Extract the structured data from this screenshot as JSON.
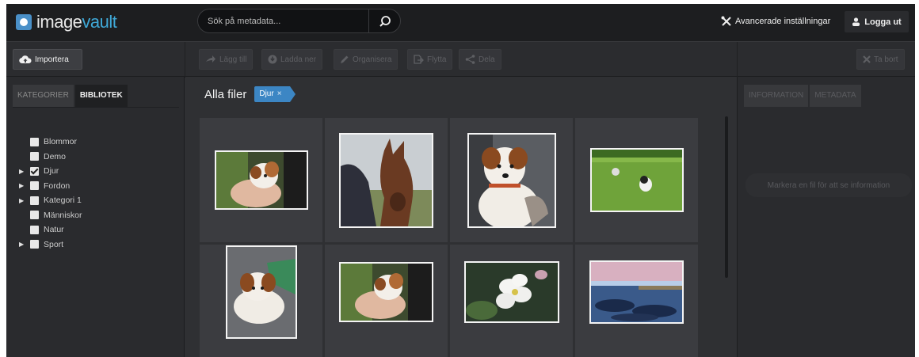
{
  "header": {
    "logo": {
      "text_main": "image",
      "text_accent": "vault",
      "icon": "camera-icon"
    },
    "search": {
      "placeholder": "Sök på metadata...",
      "icon": "search-icon"
    },
    "advanced_settings_label": "Avancerade inställningar",
    "logout_label": "Logga ut"
  },
  "toolbar": {
    "import_label": "Importera",
    "add_label": "Lägg till",
    "download_label": "Ladda ner",
    "organize_label": "Organisera",
    "move_label": "Flytta",
    "share_label": "Dela",
    "delete_label": "Ta bort"
  },
  "left_panel": {
    "tabs": [
      {
        "label": "KATEGORIER"
      },
      {
        "label": "BIBLIOTEK"
      }
    ],
    "categories": [
      {
        "label": "Blommor",
        "expandable": false,
        "checked": false
      },
      {
        "label": "Demo",
        "expandable": false,
        "checked": false
      },
      {
        "label": "Djur",
        "expandable": true,
        "checked": true
      },
      {
        "label": "Fordon",
        "expandable": true,
        "checked": false
      },
      {
        "label": "Kategori 1",
        "expandable": true,
        "checked": false
      },
      {
        "label": "Människor",
        "expandable": false,
        "checked": false
      },
      {
        "label": "Natur",
        "expandable": false,
        "checked": false
      },
      {
        "label": "Sport",
        "expandable": true,
        "checked": false
      }
    ]
  },
  "center": {
    "title": "Alla filer",
    "filter_tag": "Djur",
    "thumbnails": [
      {
        "subject": "puppy-in-hand"
      },
      {
        "subject": "foal"
      },
      {
        "subject": "jack-russell-puppy"
      },
      {
        "subject": "dogs-on-grass"
      },
      {
        "subject": "puppy-lying"
      },
      {
        "subject": "puppy-in-hand"
      },
      {
        "subject": "white-flower"
      },
      {
        "subject": "seaside-rocks"
      }
    ]
  },
  "right_panel": {
    "tabs": [
      {
        "label": "INFORMATION"
      },
      {
        "label": "METADATA"
      }
    ],
    "empty_message": "Markera en fil för att se information"
  },
  "colors": {
    "accent": "#3c86c4",
    "header_bg": "#1d1e20",
    "panel_bg": "#2a2b2e"
  }
}
